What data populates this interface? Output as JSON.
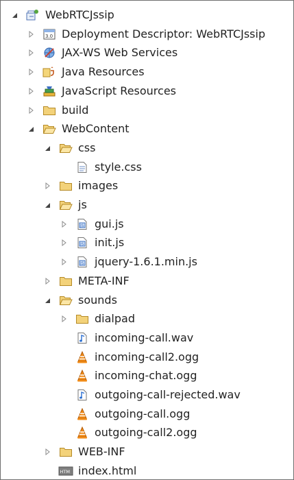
{
  "tree": [
    {
      "label": "WebRTCJssip",
      "depth": 0,
      "state": "open",
      "icon": "project-icon"
    },
    {
      "label": "Deployment Descriptor: WebRTCJssip",
      "depth": 1,
      "state": "closed",
      "icon": "deployment-descriptor-icon"
    },
    {
      "label": "JAX-WS Web Services",
      "depth": 1,
      "state": "closed",
      "icon": "web-services-icon"
    },
    {
      "label": "Java Resources",
      "depth": 1,
      "state": "closed",
      "icon": "java-resources-icon"
    },
    {
      "label": "JavaScript Resources",
      "depth": 1,
      "state": "closed",
      "icon": "javascript-resources-icon"
    },
    {
      "label": "build",
      "depth": 1,
      "state": "closed",
      "icon": "folder-icon"
    },
    {
      "label": "WebContent",
      "depth": 1,
      "state": "open",
      "icon": "folder-open-icon"
    },
    {
      "label": "css",
      "depth": 2,
      "state": "open",
      "icon": "folder-open-icon"
    },
    {
      "label": "style.css",
      "depth": 3,
      "state": "none",
      "icon": "css-file-icon"
    },
    {
      "label": "images",
      "depth": 2,
      "state": "closed",
      "icon": "folder-icon"
    },
    {
      "label": "js",
      "depth": 2,
      "state": "open",
      "icon": "folder-open-icon"
    },
    {
      "label": "gui.js",
      "depth": 3,
      "state": "closed",
      "icon": "js-file-icon"
    },
    {
      "label": "init.js",
      "depth": 3,
      "state": "closed",
      "icon": "js-file-icon"
    },
    {
      "label": "jquery-1.6.1.min.js",
      "depth": 3,
      "state": "closed",
      "icon": "js-file-icon"
    },
    {
      "label": "META-INF",
      "depth": 2,
      "state": "closed",
      "icon": "folder-icon"
    },
    {
      "label": "sounds",
      "depth": 2,
      "state": "open",
      "icon": "folder-open-icon"
    },
    {
      "label": "dialpad",
      "depth": 3,
      "state": "closed",
      "icon": "folder-icon"
    },
    {
      "label": "incoming-call.wav",
      "depth": 3,
      "state": "none",
      "icon": "audio-file-icon"
    },
    {
      "label": "incoming-call2.ogg",
      "depth": 3,
      "state": "none",
      "icon": "vlc-file-icon"
    },
    {
      "label": "incoming-chat.ogg",
      "depth": 3,
      "state": "none",
      "icon": "vlc-file-icon"
    },
    {
      "label": "outgoing-call-rejected.wav",
      "depth": 3,
      "state": "none",
      "icon": "audio-file-icon"
    },
    {
      "label": "outgoing-call.ogg",
      "depth": 3,
      "state": "none",
      "icon": "vlc-file-icon"
    },
    {
      "label": "outgoing-call2.ogg",
      "depth": 3,
      "state": "none",
      "icon": "vlc-file-icon"
    },
    {
      "label": "WEB-INF",
      "depth": 2,
      "state": "closed",
      "icon": "folder-icon"
    },
    {
      "label": "index.html",
      "depth": 2,
      "state": "none",
      "icon": "html-file-icon"
    }
  ],
  "colors": {
    "folder": "#f3d27a",
    "folder_stroke": "#b58a26",
    "vlc": "#f28c18",
    "audio": "#2b6fd1",
    "text": "#222222"
  }
}
